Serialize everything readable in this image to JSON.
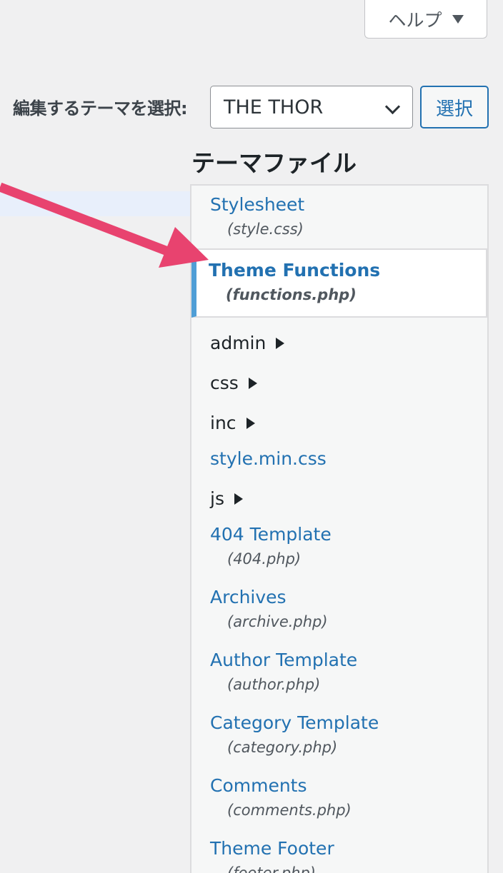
{
  "help": {
    "label": "ヘルプ"
  },
  "theme_select": {
    "label": "編集するテーマを選択:",
    "selected": "THE THOR",
    "button_label": "選択"
  },
  "files_heading": "テーマファイル",
  "files": {
    "stylesheet": {
      "name": "Stylesheet",
      "file": "(style.css)"
    },
    "functions": {
      "name": "Theme Functions",
      "file": "(functions.php)"
    },
    "folders": [
      "admin",
      "css",
      "inc",
      "js"
    ],
    "style_min": "style.min.css",
    "template_404": {
      "name": "404 Template",
      "file": "(404.php)"
    },
    "archives": {
      "name": "Archives",
      "file": "(archive.php)"
    },
    "author": {
      "name": "Author Template",
      "file": "(author.php)"
    },
    "category": {
      "name": "Category Template",
      "file": "(category.php)"
    },
    "comments": {
      "name": "Comments",
      "file": "(comments.php)"
    },
    "footer": {
      "name": "Theme Footer",
      "file": "(footer.php)"
    }
  },
  "colors": {
    "link": "#2271b1",
    "active_border": "#4f9ed6",
    "annotation_arrow": "#e8436f"
  }
}
